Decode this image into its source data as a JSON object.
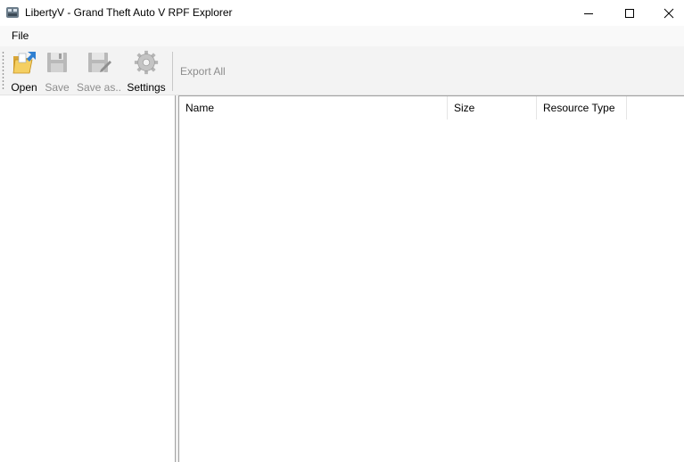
{
  "window": {
    "title": "LibertyV - Grand Theft Auto V RPF Explorer",
    "icon": "app-icon"
  },
  "menubar": {
    "items": [
      {
        "label": "File"
      }
    ]
  },
  "toolbar": {
    "buttons": [
      {
        "label": "Open",
        "icon": "open-folder-icon",
        "enabled": true
      },
      {
        "label": "Save",
        "icon": "save-disk-icon",
        "enabled": false
      },
      {
        "label": "Save as..",
        "icon": "save-as-icon",
        "enabled": false
      },
      {
        "label": "Settings",
        "icon": "gear-icon",
        "enabled": true
      }
    ],
    "export_all": {
      "label": "Export All",
      "enabled": false
    }
  },
  "list": {
    "columns": [
      {
        "label": "Name"
      },
      {
        "label": "Size"
      },
      {
        "label": "Resource Type"
      }
    ],
    "rows": []
  },
  "colors": {
    "toolbar_bg": "#f3f3f3",
    "menubar_bg": "#f9f9f9",
    "disabled_text": "#8d8d8d"
  }
}
